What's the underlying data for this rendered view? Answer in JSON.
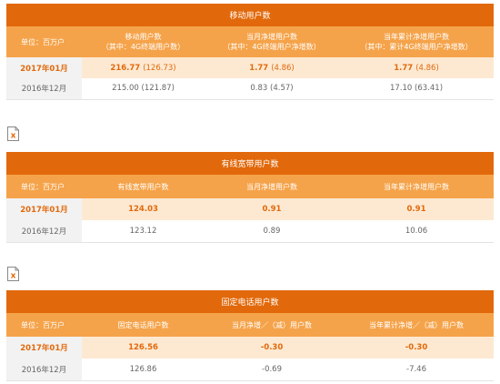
{
  "mobile": {
    "title": "移动用户数",
    "unit": "单位：百万户",
    "headers": [
      {
        "main": "移动用户数",
        "sub": "（其中：4G终端用户数）"
      },
      {
        "main": "当月净增用户数",
        "sub": "（其中：4G终端用户净增数）"
      },
      {
        "main": "当年累计净增用户数",
        "sub": "（其中：累计4G终端用户净增数）"
      }
    ],
    "rows": [
      {
        "period": "2017年01月",
        "cells": [
          {
            "main": "216.77",
            "sub": "(126.73)"
          },
          {
            "main": "1.77",
            "sub": "(4.86)"
          },
          {
            "main": "1.77",
            "sub": "(4.86)"
          }
        ]
      },
      {
        "period": "2016年12月",
        "cells": [
          {
            "main": "215.00",
            "sub": "(121.87)"
          },
          {
            "main": "0.83",
            "sub": "(4.57)"
          },
          {
            "main": "17.10",
            "sub": "(63.41)"
          }
        ]
      }
    ]
  },
  "broadband": {
    "icon": "excel-icon",
    "title": "有线宽带用户数",
    "unit": "单位：百万户",
    "headers": [
      "有线宽带用户数",
      "当月净增用户数",
      "当年累计净增用户数"
    ],
    "rows": [
      {
        "period": "2017年01月",
        "cells": [
          "124.03",
          "0.91",
          "0.91"
        ]
      },
      {
        "period": "2016年12月",
        "cells": [
          "123.12",
          "0.89",
          "10.06"
        ]
      }
    ]
  },
  "landline": {
    "icon": "excel-icon",
    "title": "固定电话用户数",
    "unit": "单位：百万户",
    "headers": [
      "固定电话用户数",
      "当月净增／（减）用户数",
      "当年累计净增／（减）用户数"
    ],
    "rows": [
      {
        "period": "2017年01月",
        "cells": [
          "126.56",
          "-0.30",
          "-0.30"
        ]
      },
      {
        "period": "2016年12月",
        "cells": [
          "126.86",
          "-0.69",
          "-7.46"
        ]
      }
    ]
  },
  "colors": {
    "header_dark": "#e2690b",
    "header_light": "#f5a34a",
    "current_row": "#fde9d2",
    "period_cell": "#f2f2f2"
  }
}
